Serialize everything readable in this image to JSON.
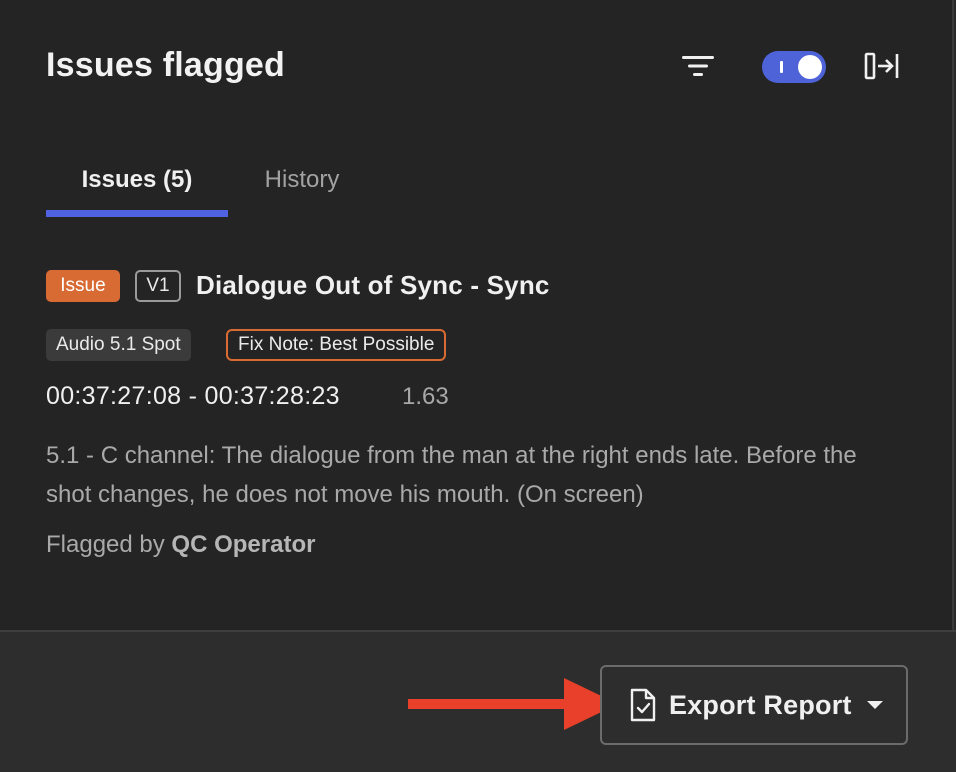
{
  "header": {
    "title": "Issues flagged",
    "filter_icon": "filter-icon",
    "toggle_state": "on",
    "collapse_icon": "collapse-panel-icon"
  },
  "tabs": [
    {
      "label": "Issues (5)",
      "active": true
    },
    {
      "label": "History",
      "active": false
    }
  ],
  "issue": {
    "type_badge": "Issue",
    "version_badge": "V1",
    "title": "Dialogue Out of Sync - Sync",
    "tags": [
      "Audio 5.1 Spot",
      "Fix Note: Best Possible"
    ],
    "timecode": "00:37:27:08 - 00:37:28:23",
    "duration": "1.63",
    "description": "5.1 - C channel: The dialogue from the man at the right ends late. Before the shot changes, he does not move his mouth. (On screen)",
    "flagged_prefix": "Flagged by",
    "flagged_by": "QC Operator"
  },
  "footer": {
    "export_label": "Export Report",
    "export_icon": "document-check-icon",
    "dropdown_icon": "caret-down-icon",
    "arrow_annotation": "red-arrow-icon"
  },
  "colors": {
    "accent": "#4f63e2",
    "issue_badge": "#d86a33",
    "annotation_arrow": "#e8402a",
    "panel_bg": "#242424"
  }
}
